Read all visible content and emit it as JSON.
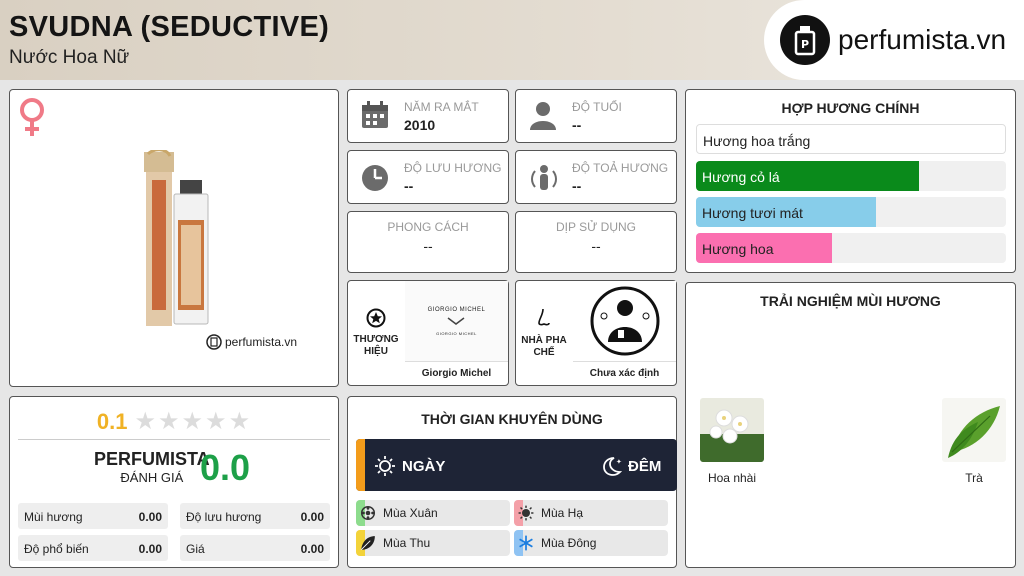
{
  "header": {
    "title": "SVUDNA (SEDUCTIVE)",
    "subtitle": "Nước Hoa Nữ",
    "logo_text": "perfumista.vn"
  },
  "product": {
    "gender_icon": "female-icon",
    "watermark": "perfumista.vn"
  },
  "info": {
    "release_label": "NĂM RA MẮT",
    "release_value": "2010",
    "age_label": "ĐỘ TUỔI",
    "age_value": "--",
    "longevity_label": "ĐỘ LƯU HƯƠNG",
    "longevity_value": "--",
    "sillage_label": "ĐỘ TOẢ HƯƠNG",
    "sillage_value": "--",
    "style_label": "PHONG CÁCH",
    "style_value": "--",
    "occasion_label": "DỊP SỬ DỤNG",
    "occasion_value": "--",
    "brand_label": "THƯƠNG HIỆU",
    "brand_name": "Giorgio Michel",
    "brand_logo_line1": "GIORGIO MICHEL",
    "brand_logo_line2": "GIORGIO MICHEL",
    "perfumer_label": "NHÀ PHA CHẾ",
    "perfumer_name": "Chưa xác định"
  },
  "accords": {
    "title": "HỢP HƯƠNG CHÍNH",
    "items": [
      {
        "label": "Hương hoa trắng",
        "percent": 100,
        "color": "#ffffff"
      },
      {
        "label": "Hương cỏ lá",
        "percent": 72,
        "color": "#0a8a1b"
      },
      {
        "label": "Hương tươi mát",
        "percent": 58,
        "color": "#87cdea"
      },
      {
        "label": "Hương hoa",
        "percent": 44,
        "color": "#fb6fb0"
      }
    ]
  },
  "rating": {
    "user_score": "0.1",
    "stars_filled": 0,
    "stars_total": 5,
    "perfumista_label": "PERFUMISTA",
    "perfumista_sub": "ĐÁNH GIÁ",
    "perfumista_score": "0.0",
    "metrics": [
      {
        "label": "Mùi hương",
        "value": "0.00"
      },
      {
        "label": "Độ lưu hương",
        "value": "0.00"
      },
      {
        "label": "Độ phổ biến",
        "value": "0.00"
      },
      {
        "label": "Giá",
        "value": "0.00"
      }
    ]
  },
  "time": {
    "title": "THỜI GIAN KHUYÊN DÙNG",
    "day_label": "NGÀY",
    "night_label": "ĐÊM",
    "seasons": [
      {
        "label": "Mùa Xuân",
        "color": "#8ddc8d",
        "icon": "flower-icon"
      },
      {
        "label": "Mùa Hạ",
        "color": "#f4a0a8",
        "icon": "sun-icon"
      },
      {
        "label": "Mùa Thu",
        "color": "#f3d33a",
        "icon": "leaf-icon"
      },
      {
        "label": "Mùa Đông",
        "color": "#8fc3f3",
        "icon": "snowflake-icon"
      }
    ]
  },
  "experience": {
    "title": "TRẢI NGHIỆM MÙI HƯƠNG",
    "notes": [
      {
        "label": "Hoa nhài"
      },
      {
        "label": "Trà"
      }
    ]
  }
}
